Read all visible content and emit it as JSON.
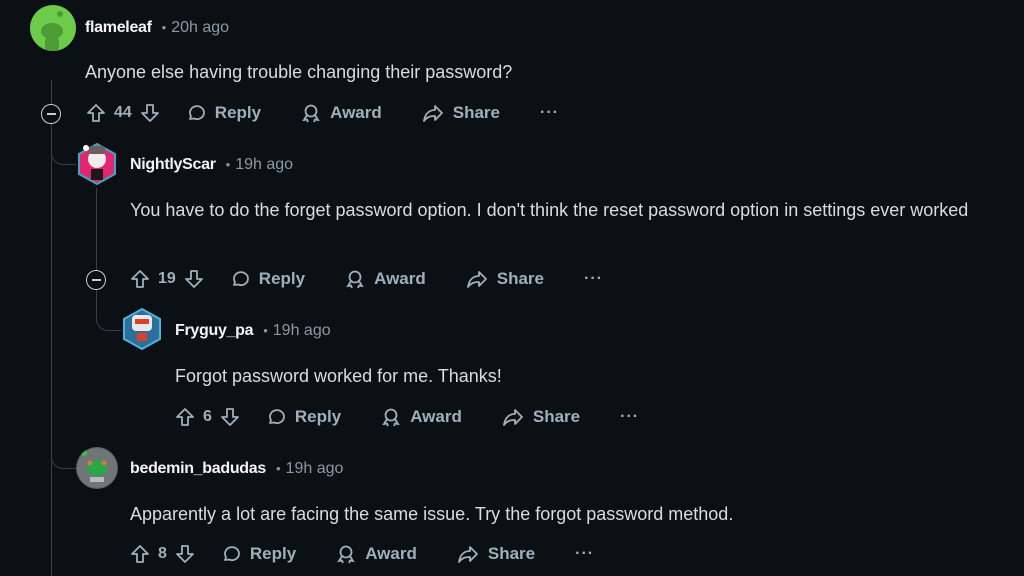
{
  "comments": [
    {
      "username": "flameleaf",
      "time": "20h ago",
      "text": "Anyone else having trouble changing their password?",
      "votes": "44",
      "avatar": "green-snoo",
      "actions": {
        "reply": "Reply",
        "award": "Award",
        "share": "Share",
        "more": "···"
      }
    },
    {
      "username": "NightlyScar",
      "time": "19h ago",
      "text": "You have to do the forget password option. I don't think the reset password option in settings ever worked",
      "votes": "19",
      "avatar": "pink-snoo-hexagon",
      "actions": {
        "reply": "Reply",
        "award": "Award",
        "share": "Share",
        "more": "···"
      }
    },
    {
      "username": "Fryguy_pa",
      "time": "19h ago",
      "text": "Forgot password worked for me. Thanks!",
      "votes": "6",
      "avatar": "robot-snoo-hexagon",
      "actions": {
        "reply": "Reply",
        "award": "Award",
        "share": "Share",
        "more": "···"
      }
    },
    {
      "username": "bedemin_badudas",
      "time": "19h ago",
      "text": "Apparently a lot are facing the same issue. Try the forgot password method.",
      "votes": "8",
      "avatar": "green-snoo-gray",
      "actions": {
        "reply": "Reply",
        "award": "Award",
        "share": "Share",
        "more": "···"
      }
    }
  ],
  "separator": "•",
  "colors": {
    "background": "#0b1014",
    "accent_green": "#6ccc4a",
    "muted": "#9fb0bb"
  }
}
